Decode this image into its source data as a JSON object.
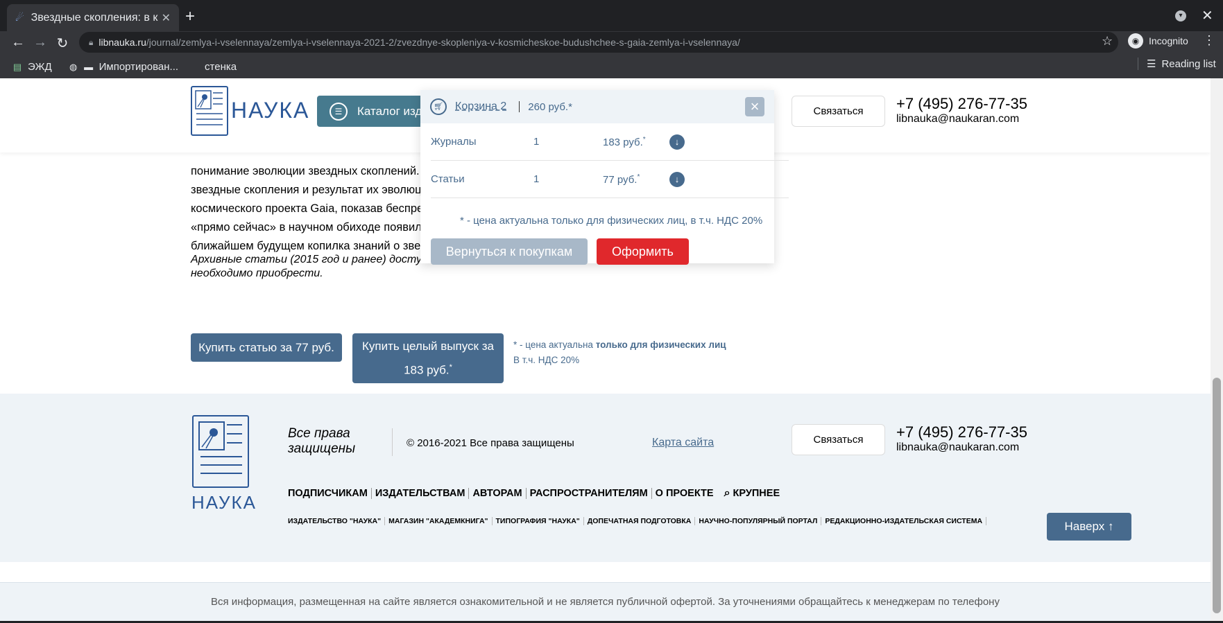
{
  "browser": {
    "tab_title": "Звездные скопления: в к",
    "url_host": "libnauka.ru",
    "url_path": "/journal/zemlya-i-vselennaya/zemlya-i-vselennaya-2021-2/zvezdnye-skopleniya-v-kosmicheskoe-budushchee-s-gaia-zemlya-i-vselennaya/",
    "incognito_label": "Incognito",
    "bookmarks": [
      "ЭЖД",
      "Импортирован...",
      "стенка"
    ],
    "reading_list": "Reading list"
  },
  "header": {
    "logo_text": "НАУКА",
    "catalog_label": "Каталог изда",
    "contact_label": "Связаться",
    "phone": "+7 (495) 276-77-35",
    "email": "libnauka@naukaran.com"
  },
  "article": {
    "lines": [
      "понимание эволюции звездных скоплений. М",
      "звездные скопления и результат их эволюци",
      "космического проекта Gaia, показав беспрец",
      "«прямо сейчас» в научном обиходе появила",
      "ближайшем будущем копилка знаний о звезд"
    ],
    "archive_line1": "Архивные статьи (2015 год и ранее) досту",
    "archive_line2": "необходимо приобрести."
  },
  "buy": {
    "article_label": "Купить статью за 77 руб.",
    "issue_line1": "Купить целый выпуск за",
    "issue_line2": "183 руб.",
    "issue_star": "*",
    "note_prefix": "* - цена актуальна ",
    "note_bold": "только для физических лиц",
    "note_line2": "В т.ч. НДС 20%"
  },
  "cart": {
    "link": "Корзина 2",
    "total": "260 руб.*",
    "close": "×",
    "rows": [
      {
        "name": "Журналы",
        "qty": "1",
        "price": "183 руб.",
        "star": "*"
      },
      {
        "name": "Статьи",
        "qty": "1",
        "price": "77 руб.",
        "star": "*"
      }
    ],
    "note": "* - цена актуальна только для физических лиц, в т.ч. НДС 20%",
    "back_label": "Вернуться к покупкам",
    "checkout_label": "Оформить"
  },
  "footer": {
    "logo_text": "НАУКА",
    "rights_line1": "Все права",
    "rights_line2": "защищены",
    "copyright": "© 2016-2021 Все права защищены",
    "sitemap": "Карта сайта",
    "contact_label": "Связаться",
    "phone": "+7 (495) 276-77-35",
    "email": "libnauka@naukaran.com",
    "menu": [
      "ПОДПИСЧИКАМ",
      "ИЗДАТЕЛЬСТВАМ",
      "АВТОРАМ",
      "РАСПРОСТРАНИТЕЛЯМ",
      "О ПРОЕКТЕ"
    ],
    "bigger_label": "КРУПНЕЕ",
    "submenu": [
      "ИЗДАТЕЛЬСТВО \"НАУКА\"",
      "МАГАЗИН \"АКАДЕМКНИГА\"",
      "ТИПОГРАФИЯ \"НАУКА\"",
      "ДОПЕЧАТНАЯ ПОДГОТОВКА",
      "НАУЧНО-ПОПУЛЯРНЫЙ ПОРТАЛ",
      "РЕДАКЦИОННО-ИЗДАТЕЛЬСКАЯ СИСТЕМА"
    ],
    "up_label": "Наверх ↑",
    "disclaimer": "Вся информация, размещенная на сайте является ознакомительной и не является публичной офертой. За уточнениями обращайтесь к менеджерам по телефону"
  },
  "colors": {
    "accent": "#476a8d",
    "checkout": "#e0282c",
    "footer_bg": "#eef3f7"
  }
}
